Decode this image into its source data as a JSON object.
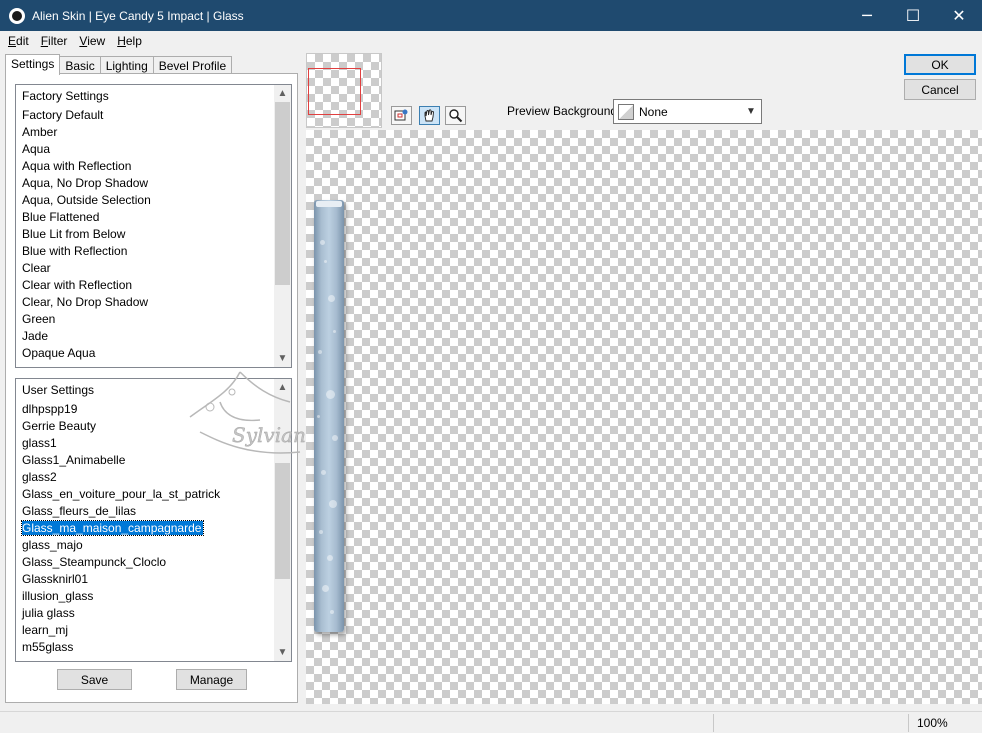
{
  "window": {
    "title": "Alien Skin | Eye Candy 5 Impact | Glass",
    "minimize_glyph": "─",
    "maximize_glyph": "☐",
    "close_glyph": "✕"
  },
  "menu": {
    "items": [
      {
        "underline": "E",
        "rest": "dit"
      },
      {
        "underline": "F",
        "rest": "ilter"
      },
      {
        "underline": "V",
        "rest": "iew"
      },
      {
        "underline": "H",
        "rest": "elp"
      }
    ]
  },
  "tabs": [
    "Settings",
    "Basic",
    "Lighting",
    "Bevel Profile"
  ],
  "factory_settings": {
    "header": "Factory Settings",
    "items": [
      "Factory Default",
      "Amber",
      "Aqua",
      "Aqua with Reflection",
      "Aqua, No Drop Shadow",
      "Aqua, Outside Selection",
      "Blue Flattened",
      "Blue Lit from Below",
      "Blue with Reflection",
      "Clear",
      "Clear with Reflection",
      "Clear, No Drop Shadow",
      "Green",
      "Jade",
      "Opaque Aqua"
    ]
  },
  "user_settings": {
    "header": "User Settings",
    "items": [
      "dlhpspp19",
      "Gerrie Beauty",
      "glass1",
      "Glass1_Animabelle",
      "glass2",
      "Glass_en_voiture_pour_la_st_patrick",
      "Glass_fleurs_de_lilas",
      "Glass_ma_maison_campagnarde",
      "glass_majo",
      "Glass_Steampunck_Cloclo",
      "Glassknirl01",
      "illusion_glass",
      "julia glass",
      "learn_mj",
      "m55glass"
    ],
    "selected": "Glass_ma_maison_campagnarde"
  },
  "buttons": {
    "save": "Save",
    "manage": "Manage",
    "ok": "OK",
    "cancel": "Cancel"
  },
  "tools": [
    "navigator-icon",
    "hand-icon",
    "zoom-icon"
  ],
  "preview_background": {
    "label": "Preview Background:",
    "value": "None"
  },
  "status": {
    "zoom": "100%"
  },
  "watermark": {
    "text": "Sylviane"
  },
  "colors": {
    "titlebar": "#1f4a6f",
    "selection": "#0078d7",
    "glass": "#a9bed1",
    "nav_rect": "#e04040"
  }
}
